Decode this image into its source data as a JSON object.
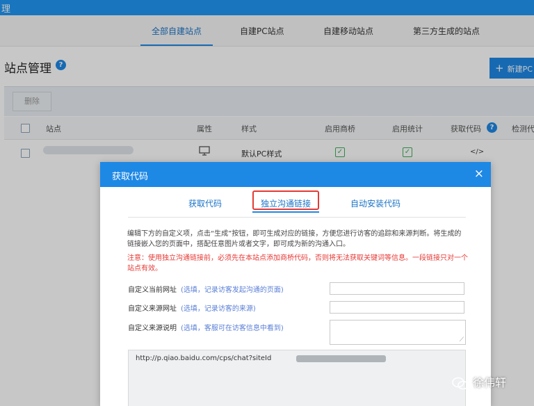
{
  "app": {
    "title_fragment": "理"
  },
  "nav_tabs": [
    {
      "label": "全部自建站点"
    },
    {
      "label": "自建PC站点"
    },
    {
      "label": "自建移动站点"
    },
    {
      "label": "第三方生成的站点"
    }
  ],
  "page": {
    "title": "站点管理",
    "help_glyph": "?",
    "new_site_label": "新建PC"
  },
  "toolbar": {
    "delete_label": "删除"
  },
  "table": {
    "columns": [
      "站点",
      "属性",
      "样式",
      "启用商桥",
      "启用统计",
      "获取代码",
      "检测代"
    ],
    "rows": [
      {
        "style": "默认PC样式",
        "code_glyph": "</>"
      }
    ]
  },
  "modal": {
    "title": "获取代码",
    "close_glyph": "×",
    "tabs": [
      {
        "label": "获取代码"
      },
      {
        "label": "独立沟通链接"
      },
      {
        "label": "自动安装代码"
      }
    ],
    "description": "编辑下方的自定义项，点击“生成”按钮，即可生成对应的链接，方便您进行访客的追踪和来源判断。将生成的链接嵌入您的页面中，搭配任意图片或者文字，即可成为新的沟通入口。",
    "notice": "注意：使用独立沟通链接前，必须先在本站点添加商桥代码，否则将无法获取关键词等信息。一段链接只对一个站点有效。",
    "fields": [
      {
        "label": "自定义当前网址",
        "hint": "(选填，记录访客发起沟通的页面)"
      },
      {
        "label": "自定义来源网址",
        "hint": "(选填，记录访客的来源)"
      },
      {
        "label": "自定义来源说明",
        "hint": "(选填，客服可在访客信息中看到)"
      }
    ],
    "link_prefix": "http://p.qiao.baidu.com/cps/chat?siteId"
  },
  "watermark": {
    "text": "徐伟轩"
  },
  "colors": {
    "primary": "#1e88e5",
    "notice_red": "#e53935",
    "check_green": "#3fae5a",
    "hint_blue": "#5a7fd6"
  }
}
